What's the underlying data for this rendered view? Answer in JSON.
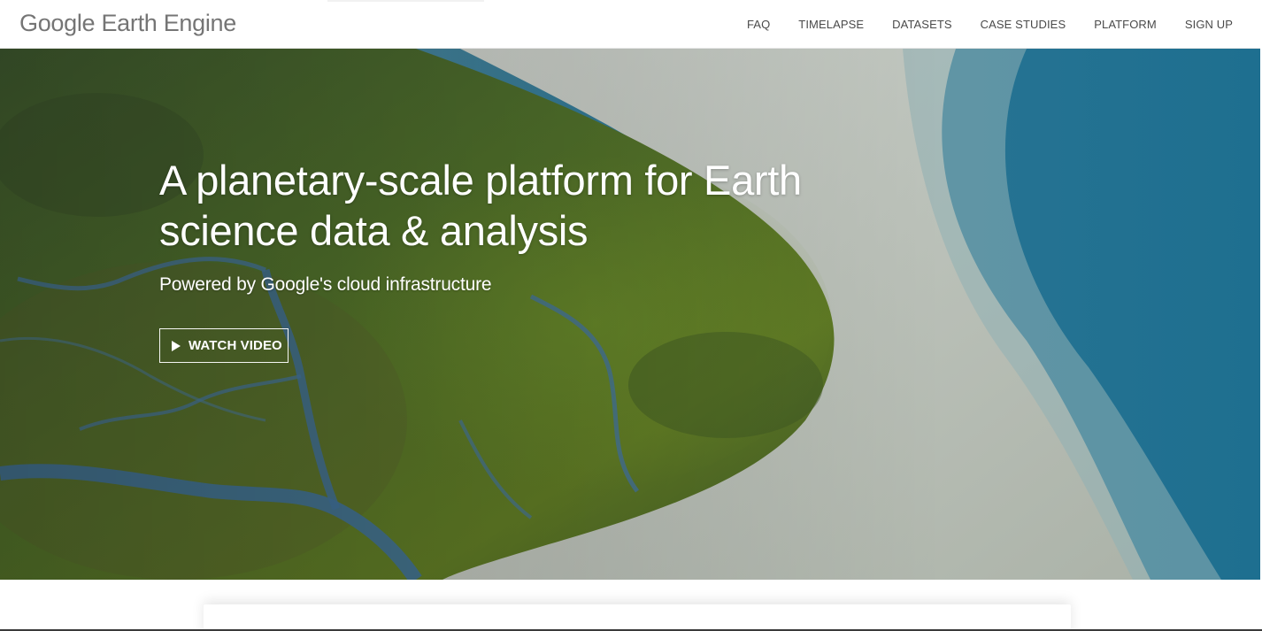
{
  "header": {
    "logo_text": "Google Earth Engine",
    "nav": [
      {
        "label": "FAQ"
      },
      {
        "label": "TIMELAPSE"
      },
      {
        "label": "DATASETS"
      },
      {
        "label": "CASE STUDIES"
      },
      {
        "label": "PLATFORM"
      },
      {
        "label": "SIGN UP"
      }
    ]
  },
  "hero": {
    "title": "A planetary-scale platform for Earth science data & analysis",
    "subtitle": "Powered by Google's cloud infrastructure",
    "watch_button_label": "WATCH VIDEO",
    "button_icon": "play-icon"
  },
  "colors": {
    "logo": "#757575",
    "nav_text": "#4a4a4a",
    "hero_text": "#ffffff"
  }
}
